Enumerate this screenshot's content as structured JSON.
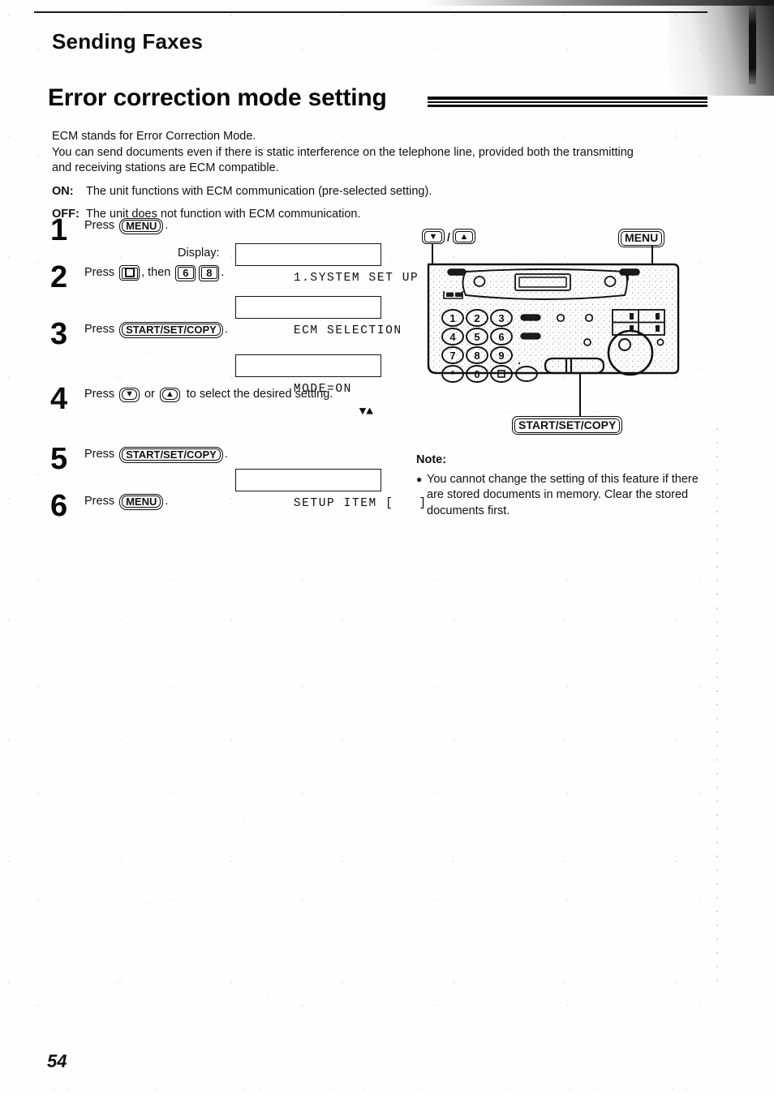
{
  "page": {
    "running_head": "Sending Faxes",
    "chapter_title": "Error correction mode setting",
    "page_number": "54"
  },
  "intro": {
    "line1": "ECM stands for Error Correction Mode.",
    "line2": "You can send documents even if there is static interference on the telephone line, provided both the transmitting and receiving stations are ECM compatible.",
    "on_label": "ON:",
    "on_text": "The unit functions with ECM communication (pre-selected setting).",
    "off_label": "OFF:",
    "off_text": "The unit does not function with ECM communication."
  },
  "steps": [
    {
      "num": "1",
      "press_word": "Press",
      "key": "MENU",
      "period": ".",
      "display_label": "Display:",
      "lcd": "1.SYSTEM SET UP"
    },
    {
      "num": "2",
      "press_word": "Press",
      "key_hash": "#",
      "then_word": ", then",
      "key_a": "6",
      "key_b": "8",
      "period": ".",
      "lcd": "ECM SELECTION"
    },
    {
      "num": "3",
      "press_word": "Press",
      "key": "START/SET/COPY",
      "period": ".",
      "lcd": "MODE=ON",
      "lcd_right": "▼▲"
    },
    {
      "num": "4",
      "press_word": "Press",
      "key_down": "▼",
      "or_word": "or",
      "key_up": "▲",
      "tail": "to select the desired setting."
    },
    {
      "num": "5",
      "press_word": "Press",
      "key": "START/SET/COPY",
      "period": ".",
      "lcd": "SETUP ITEM [   ]"
    },
    {
      "num": "6",
      "press_word": "Press",
      "key": "MENU",
      "period": "."
    }
  ],
  "diagram": {
    "callout_updown_down": "▼",
    "callout_updown_sep": "/",
    "callout_updown_up": "▲",
    "callout_menu": "MENU",
    "callout_start": "START/SET/COPY",
    "keypad": [
      [
        "1",
        "2",
        "3"
      ],
      [
        "4",
        "5",
        "6"
      ],
      [
        "7",
        "8",
        "9"
      ],
      [
        "∗",
        "0",
        "□"
      ]
    ]
  },
  "note": {
    "title": "Note:",
    "bullet": "●",
    "text": "You cannot change the setting of this feature if there are stored documents in memory. Clear the stored documents first."
  },
  "colors": {
    "ink": "#101010",
    "paper": "#fefefe",
    "rule": "#0a0a0a"
  }
}
